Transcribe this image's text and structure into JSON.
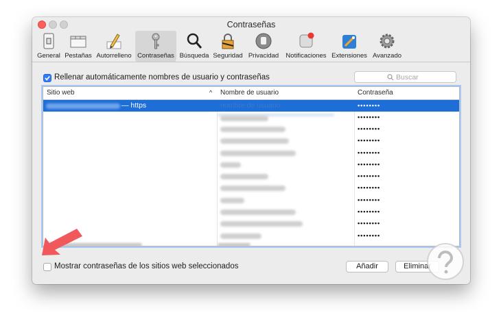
{
  "window": {
    "title": "Contraseñas"
  },
  "toolbar": {
    "items": [
      {
        "label": "General",
        "icon": "general-switch-icon"
      },
      {
        "label": "Pestañas",
        "icon": "tabs-icon"
      },
      {
        "label": "Autorrelleno",
        "icon": "pencil-icon"
      },
      {
        "label": "Contraseñas",
        "icon": "key-icon",
        "active": true
      },
      {
        "label": "Búsqueda",
        "icon": "magnifier-icon"
      },
      {
        "label": "Seguridad",
        "icon": "lock-icon"
      },
      {
        "label": "Privacidad",
        "icon": "hand-icon"
      },
      {
        "label": "Notificaciones",
        "icon": "notification-icon"
      },
      {
        "label": "Extensiones",
        "icon": "puzzle-icon"
      },
      {
        "label": "Avanzado",
        "icon": "gear-icon"
      }
    ]
  },
  "autofill": {
    "label": "Rellenar automáticamente nombres de usuario y contraseñas",
    "checked": true
  },
  "search": {
    "placeholder": "Buscar"
  },
  "table": {
    "headers": {
      "site": "Sitio web",
      "user": "Nombre de usuario",
      "password": "Contraseña"
    },
    "selected_row": {
      "site_suffix": "— https",
      "user": "nombre de usuario",
      "password": "••••••••"
    },
    "password_mask": "••••••••"
  },
  "show_passwords": {
    "label": "Mostrar contraseñas de los sitios web seleccionados",
    "checked": false
  },
  "buttons": {
    "add": "Añadir",
    "remove": "Eliminar"
  },
  "colors": {
    "selection": "#1e6ed8",
    "checkbox_on": "#2f7cf6",
    "arrow": "#f0585c"
  }
}
